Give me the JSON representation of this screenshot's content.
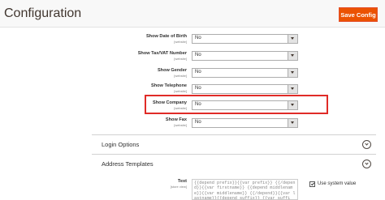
{
  "header": {
    "title": "Configuration",
    "save_label": "Save Config"
  },
  "rows": [
    {
      "label": "Show Date of Birth",
      "scope": "[website]",
      "value": "No"
    },
    {
      "label": "Show Tax/VAT Number",
      "scope": "[website]",
      "value": "No"
    },
    {
      "label": "Show Gender",
      "scope": "[website]",
      "value": "No"
    },
    {
      "label": "Show Telephone",
      "scope": "[website]",
      "value": "No"
    },
    {
      "label": "Show Company",
      "scope": "[website]",
      "value": "No"
    },
    {
      "label": "Show Fax",
      "scope": "[website]",
      "value": "No"
    }
  ],
  "sections": {
    "login": {
      "title": "Login Options"
    },
    "address": {
      "title": "Address Templates"
    }
  },
  "address_text": {
    "label": "Text",
    "scope": "[store view]",
    "value": "{{depend prefix}}{{var prefix}} {{/depend}}{{var firstname}} {{depend middlename}}{{var middlename}} {{/depend}}{{var lastname}}{{depend suffix}} {{var suffix}}{{/depend}}",
    "use_system_value_label": "Use system value",
    "use_system_value": true
  },
  "colors": {
    "accent": "#eb5202",
    "highlight": "#e02b27"
  }
}
